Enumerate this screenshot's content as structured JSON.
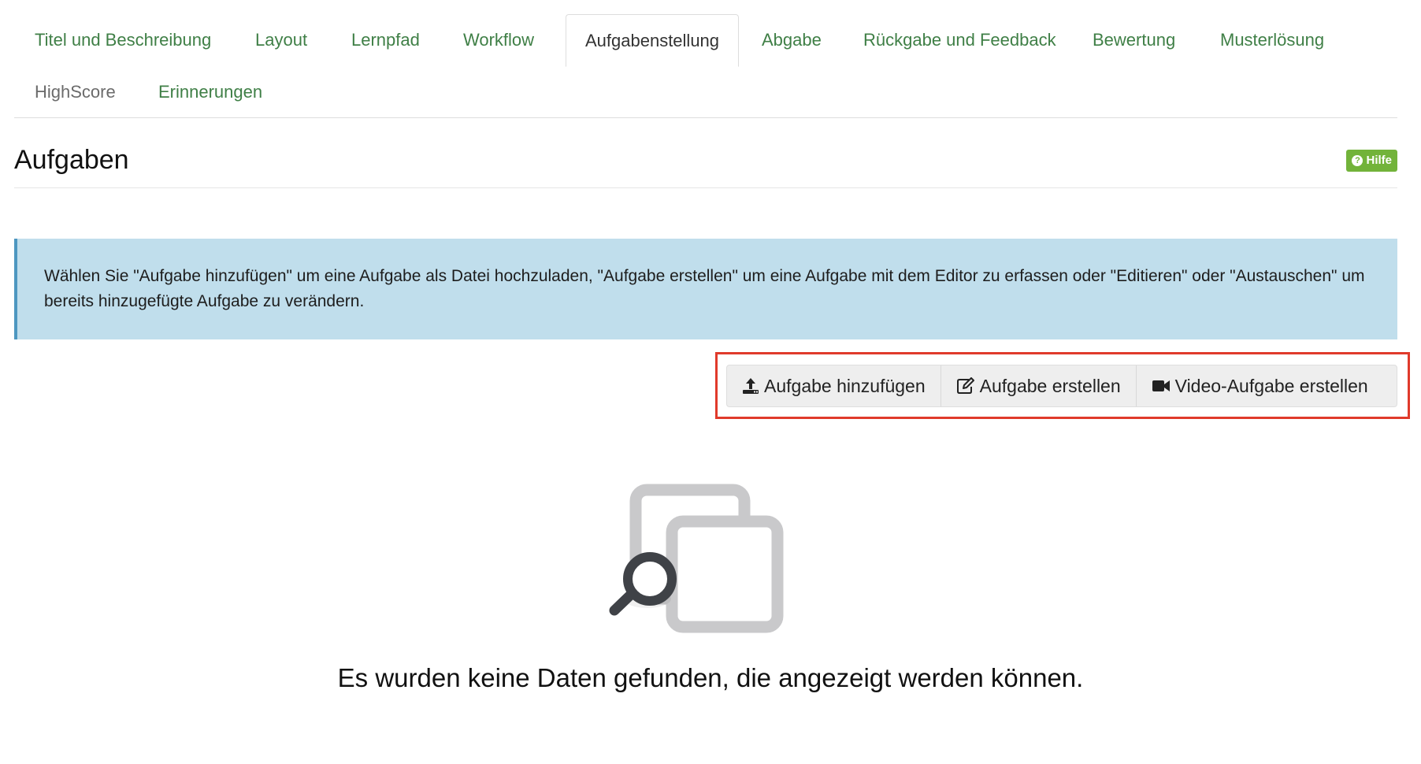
{
  "tabs": [
    {
      "label": "Titel und Beschreibung"
    },
    {
      "label": "Layout"
    },
    {
      "label": "Lernpfad"
    },
    {
      "label": "Workflow"
    },
    {
      "label": "Aufgabenstellung",
      "active": true
    },
    {
      "label": "Abgabe"
    },
    {
      "label": "Rückgabe und Feedback"
    },
    {
      "label": "Bewertung"
    },
    {
      "label": "Musterlösung"
    },
    {
      "label": "HighScore"
    },
    {
      "label": "Erinnerungen"
    }
  ],
  "section": {
    "title": "Aufgaben",
    "help_label": "Hilfe",
    "help_icon": "question-circle-icon"
  },
  "info": {
    "text": "Wählen Sie \"Aufgabe hinzufügen\" um eine Aufgabe als Datei hochzuladen, \"Aufgabe erstellen\" um eine Aufgabe mit dem Editor zu erfassen oder \"Editieren\" oder \"Austauschen\" um bereits hinzugefügte Aufgabe zu verändern."
  },
  "actions": {
    "add_label": "Aufgabe hinzufügen",
    "add_icon": "upload-icon",
    "create_label": "Aufgabe erstellen",
    "create_icon": "edit-icon",
    "video_label": "Video-Aufgabe erstellen",
    "video_icon": "video-camera-icon"
  },
  "empty_state": {
    "icon": "documents-search-icon",
    "message": "Es wurden keine Daten gefunden, die angezeigt werden können."
  },
  "colors": {
    "tab_link": "#3f7f46",
    "info_bg": "#c0deec",
    "help_bg": "#72b33a",
    "highlight": "#e03a2b"
  }
}
